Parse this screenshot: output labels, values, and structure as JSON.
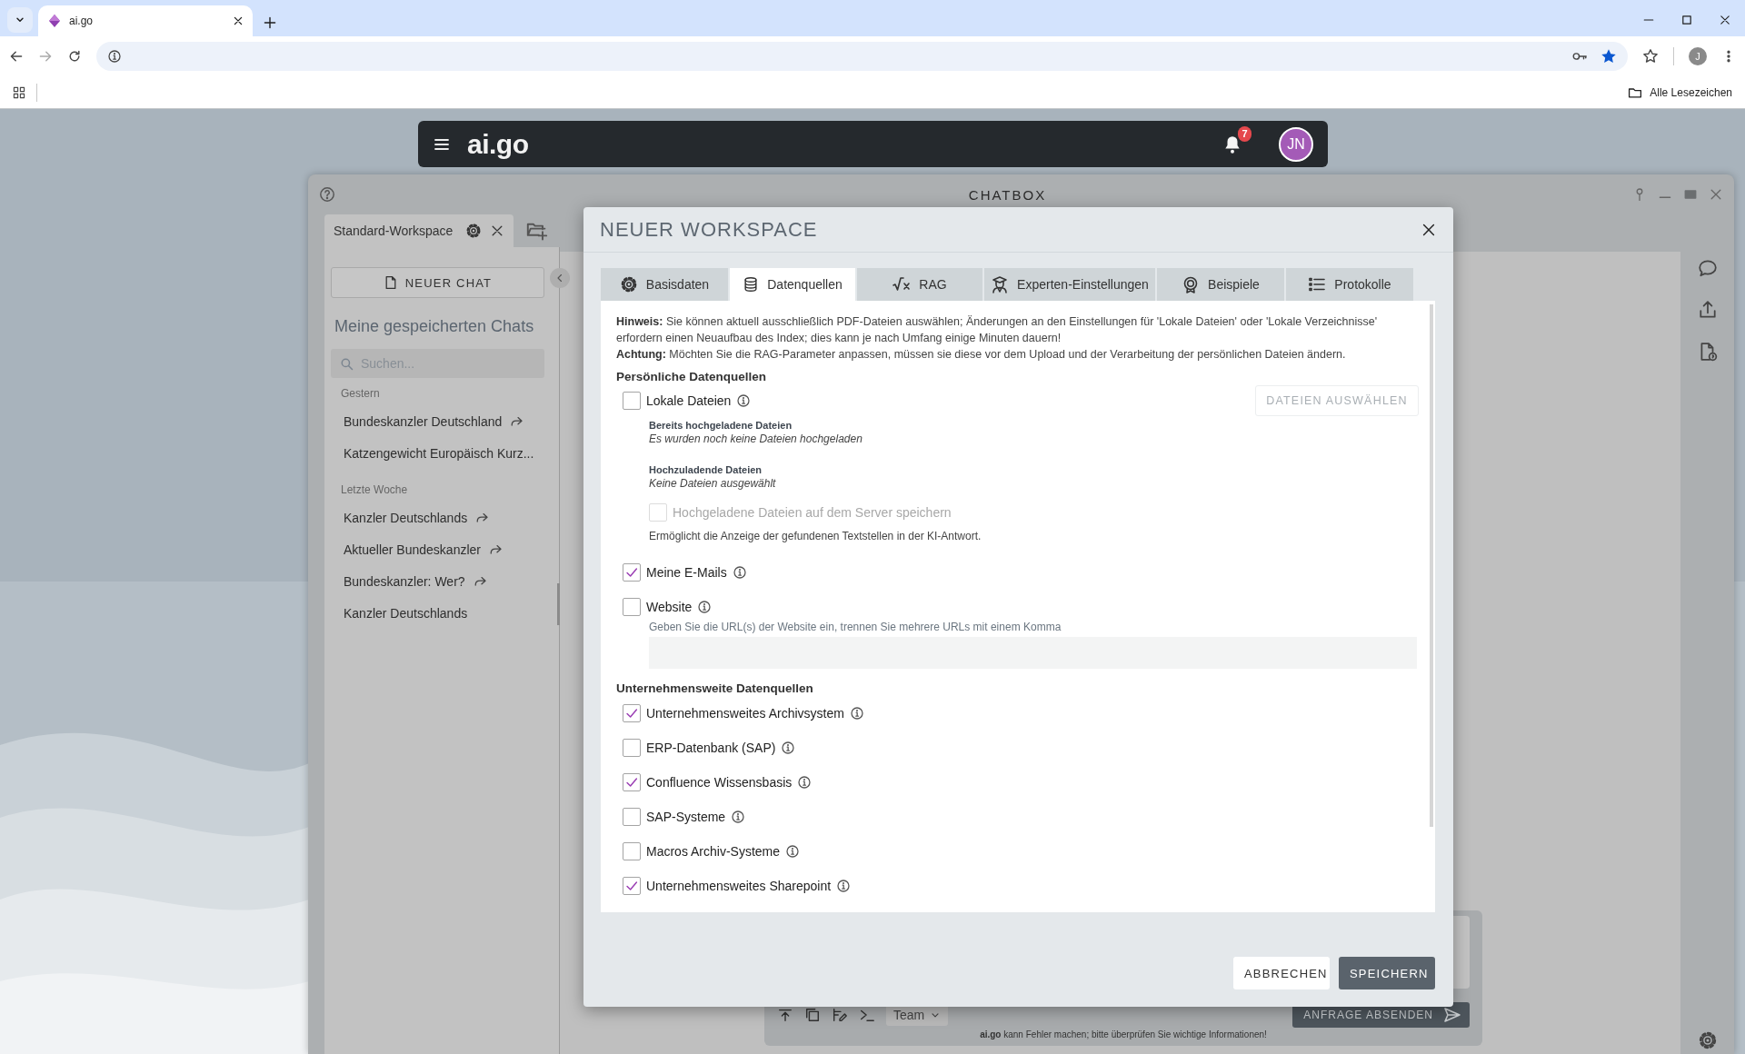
{
  "browser": {
    "tab_title": "ai.go",
    "bookmarks_label": "Alle Lesezeichen",
    "profile_initial": "J"
  },
  "app_bar": {
    "logo": "ai.go",
    "notification_count": "7",
    "avatar_initials": "JN"
  },
  "chatbox": {
    "title": "CHATBOX",
    "workspace_tab": "Standard-Workspace",
    "new_chat_button": "NEUER CHAT",
    "saved_chats_heading": "Meine gespeicherten Chats",
    "search": {
      "placeholder": "Suchen..."
    },
    "chat_groups": [
      {
        "label": "Gestern",
        "chats": [
          {
            "title": "Bundeskanzler Deutschland",
            "shared": true
          },
          {
            "title": "Katzengewicht Europäisch Kurz...",
            "shared": false
          }
        ]
      },
      {
        "label": "Letzte Woche",
        "chats": [
          {
            "title": "Kanzler Deutschlands",
            "shared": true
          },
          {
            "title": "Aktueller Bundeskanzler",
            "shared": true
          },
          {
            "title": "Bundeskanzler: Wer?",
            "shared": true
          },
          {
            "title": "Kanzler Deutschlands",
            "shared": false
          }
        ]
      }
    ],
    "composer": {
      "mode": "Team",
      "send_button": "ANFRAGE ABSENDEN",
      "disclaimer": "**ai.go** kann Fehler machen; bitte überprüfen Sie wichtige Informationen!"
    }
  },
  "dialog": {
    "title": "NEUER WORKSPACE",
    "tabs": [
      {
        "label": "Basisdaten",
        "selected": false
      },
      {
        "label": "Datenquellen",
        "selected": true
      },
      {
        "label": "RAG",
        "selected": false
      },
      {
        "label": "Experten-Einstellungen",
        "selected": false
      },
      {
        "label": "Beispiele",
        "selected": false
      },
      {
        "label": "Protokolle",
        "selected": false
      }
    ],
    "notices": [
      "**Hinweis:** Sie können aktuell ausschließlich PDF-Dateien auswählen; Änderungen an den Einstellungen für 'Lokale Dateien' oder 'Lokale Verzeichnisse' erfordern einen Neuaufbau des Index; dies kann je nach Umfang einige Minuten dauern!",
      "**Achtung:** Möchten Sie die RAG-Parameter anpassen, müssen sie diese vor dem Upload und der Verarbeitung der persönlichen Dateien ändern."
    ],
    "personal_heading": "Persönliche Datenquellen",
    "local_files": {
      "label": "Lokale Dateien",
      "checked": false,
      "select_button": {
        "label": "DATEIEN AUSWÄHLEN",
        "disabled": true
      },
      "uploaded_label": "Bereits hochgeladene Dateien",
      "uploaded_value": "Es wurden noch keine Dateien hochgeladen",
      "pending_label": "Hochzuladende Dateien",
      "pending_value": "Keine Dateien ausgewählt",
      "store_option": {
        "label": "Hochgeladene Dateien auf dem Server speichern",
        "checked": false,
        "disabled": true
      },
      "store_hint": "Ermöglicht die Anzeige der gefundenen Textstellen in der KI-Antwort."
    },
    "emails": {
      "label": "Meine E-Mails",
      "checked": true
    },
    "website": {
      "label": "Website",
      "checked": false,
      "hint": "Geben Sie die URL(s) der Website ein, trennen Sie mehrere URLs mit einem Komma"
    },
    "enterprise_heading": "Unternehmensweite Datenquellen",
    "enterprise_sources": [
      {
        "label": "Unternehmensweites Archivsystem",
        "checked": true
      },
      {
        "label": "ERP-Datenbank (SAP)",
        "checked": false
      },
      {
        "label": "Confluence Wissensbasis",
        "checked": true
      },
      {
        "label": "SAP-Systeme",
        "checked": false
      },
      {
        "label": "Macros Archiv-Systeme",
        "checked": false
      },
      {
        "label": "Unternehmensweites Sharepoint",
        "checked": true
      }
    ],
    "buttons": {
      "cancel": "ABBRECHEN",
      "save": "SPEICHERN"
    }
  }
}
